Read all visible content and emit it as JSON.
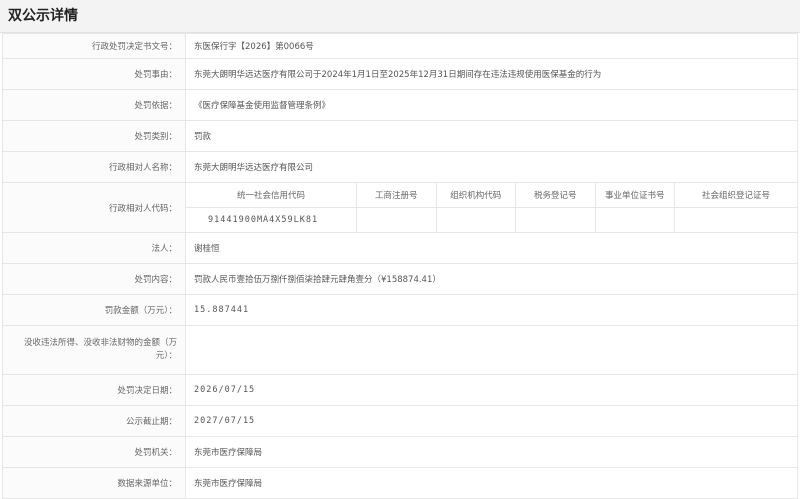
{
  "page": {
    "title": "双公示详情"
  },
  "rows": [
    {
      "label": "行政处罚决定书文号：",
      "value": "东医保行字【2026】第0066号"
    },
    {
      "label": "处罚事由：",
      "value": "东莞大朗明华远达医疗有限公司于2024年1月1日至2025年12月31日期间存在违法违规使用医保基金的行为"
    },
    {
      "label": "处罚依据：",
      "value": "《医疗保障基金使用监督管理条例》"
    },
    {
      "label": "处罚类别：",
      "value": "罚款"
    },
    {
      "label": "行政相对人名称：",
      "value": "东莞大朗明华远达医疗有限公司"
    }
  ],
  "codes": {
    "label": "行政相对人代码：",
    "headers": [
      "统一社会信用代码",
      "工商注册号",
      "组织机构代码",
      "税务登记号",
      "事业单位证书号",
      "社会组织登记证号"
    ],
    "values": [
      "91441900MA4X59LK81",
      "",
      "",
      "",
      "",
      ""
    ]
  },
  "rows2": [
    {
      "label": "法人：",
      "value": "谢桂恒"
    },
    {
      "label": "处罚内容：",
      "value": "罚款人民币壹拾伍万捌仟捌佰柒拾肆元肆角壹分（¥158874.41）"
    },
    {
      "label": "罚款金额（万元）：",
      "value": "15.887441"
    }
  ],
  "confiscation": {
    "label": "没收违法所得、没收非法财物的金额（万元）：",
    "value": ""
  },
  "rows3": [
    {
      "label": "处罚决定日期：",
      "value": "2026/07/15"
    },
    {
      "label": "公示截止期：",
      "value": "2027/07/15"
    },
    {
      "label": "处罚机关：",
      "value": "东莞市医疗保障局"
    },
    {
      "label": "数据来源单位：",
      "value": "东莞市医疗保障局"
    }
  ]
}
